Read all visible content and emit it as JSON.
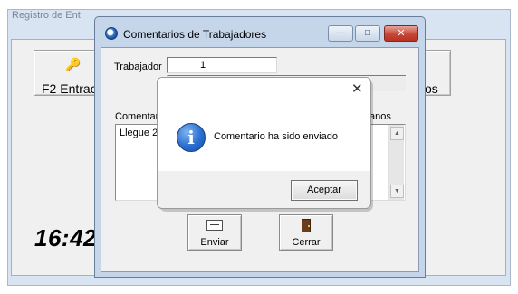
{
  "main_window": {
    "title": "Registro de Ent",
    "f2_button_label": "F2 Entrac",
    "right_button_label": "os",
    "clock": "16:42"
  },
  "comments_dialog": {
    "title": "Comentarios de Trabajadores",
    "trabajador_label": "Trabajador",
    "trabajador_value": "1",
    "comentarios_label": "Comentar",
    "anos_label": "anos",
    "comment_text": "Llegue 2",
    "enviar_label": "Enviar",
    "cerrar_label": "Cerrar",
    "window_controls": {
      "minimize": "—",
      "maximize": "□",
      "close": "✕"
    }
  },
  "message_box": {
    "close_glyph": "✕",
    "info_glyph": "i",
    "message": "Comentario ha sido enviado",
    "ok_label": "Aceptar"
  },
  "icons": {
    "app": "app-globe-icon",
    "key": "key-icon",
    "send": "send-mail-icon",
    "exit": "exit-door-icon",
    "info": "info-icon"
  },
  "colors": {
    "title_bar": "#c6d6ea",
    "close_button": "#c8473a",
    "info_blue": "#2a6fd0"
  }
}
